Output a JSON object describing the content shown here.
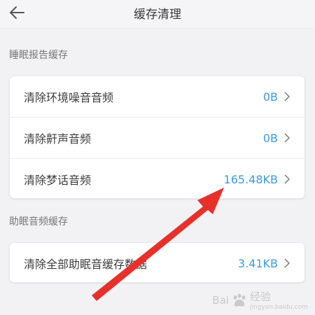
{
  "header": {
    "title": "缓存清理"
  },
  "sections": [
    {
      "label": "睡眠报告缓存",
      "rows": [
        {
          "label": "清除环境噪音音频",
          "value": "0B"
        },
        {
          "label": "清除鼾声音频",
          "value": "0B"
        },
        {
          "label": "清除梦话音频",
          "value": "165.48KB"
        }
      ]
    },
    {
      "label": "助眠音频缓存",
      "rows": [
        {
          "label": "清除全部助眠音缓存数据",
          "value": "3.41KB"
        }
      ]
    }
  ],
  "watermark": {
    "text1": "Bai",
    "text2": "经验",
    "sub": "jingyan.baidu.com"
  },
  "colors": {
    "value": "#3a9be8",
    "arrow": "#e8302b",
    "background": "#f2f2f4"
  },
  "icons": [
    "back-arrow-icon",
    "chevron-right-icon",
    "baidu-paw-icon"
  ]
}
